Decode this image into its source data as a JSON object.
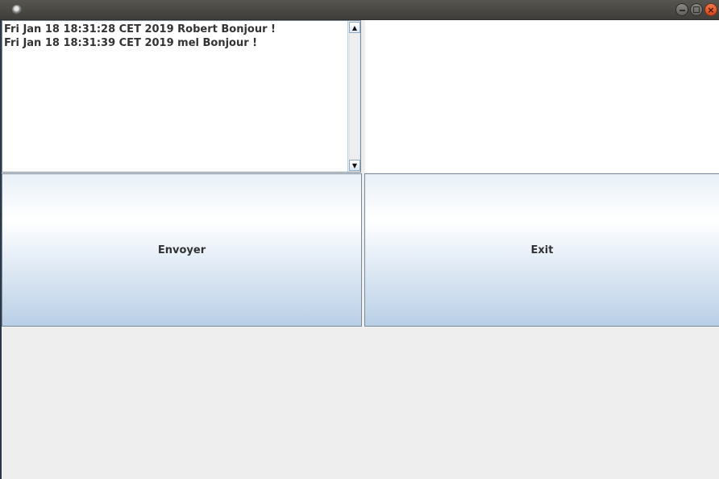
{
  "titlebar": {
    "title": ""
  },
  "chat": {
    "messages": [
      "Fri Jan 18 18:31:28 CET 2019 Robert Bonjour !",
      "Fri Jan 18 18:31:39 CET 2019 mel Bonjour !"
    ],
    "scroll_up_glyph": "▲",
    "scroll_down_glyph": "▼"
  },
  "buttons": {
    "send_label": "Envoyer",
    "exit_label": "Exit"
  },
  "colors": {
    "button_gradient_top": "#ffffff",
    "button_gradient_bottom": "#b9cfe6",
    "close_button": "#e0552a"
  },
  "icons": {
    "app": "app-icon",
    "minimize": "minimize-icon",
    "maximize": "maximize-icon",
    "close": "close-icon"
  }
}
